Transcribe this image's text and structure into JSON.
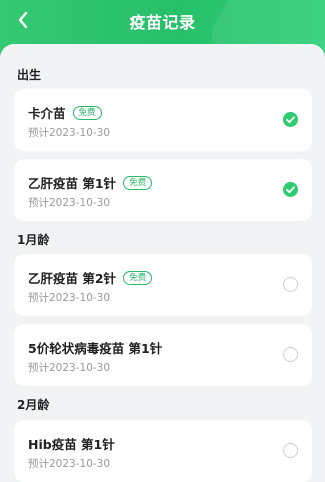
{
  "header": {
    "title": "疫苗记录",
    "back_icon": "chevron-left-icon",
    "bg_color": "#2bc46d"
  },
  "sections": [
    {
      "label": "出生",
      "items": [
        {
          "name": "卡介苗",
          "badge": "免费",
          "planned": "预计2023-10-30",
          "status": "done"
        },
        {
          "name": "乙肝疫苗 第1针",
          "badge": "免费",
          "planned": "预计2023-10-30",
          "status": "done"
        }
      ]
    },
    {
      "label": "1月龄",
      "items": [
        {
          "name": "乙肝疫苗 第2针",
          "badge": "免费",
          "planned": "预计2023-10-30",
          "status": "pending"
        },
        {
          "name": "5价轮状病毒疫苗 第1针",
          "badge": "",
          "planned": "预计2023-10-30",
          "status": "pending"
        }
      ]
    },
    {
      "label": "2月龄",
      "items": [
        {
          "name": "Hib疫苗 第1针",
          "badge": "",
          "planned": "预计2023-10-30",
          "status": "pending"
        }
      ]
    }
  ],
  "colors": {
    "accent": "#2dcc70",
    "background": "#f2f3f5"
  }
}
